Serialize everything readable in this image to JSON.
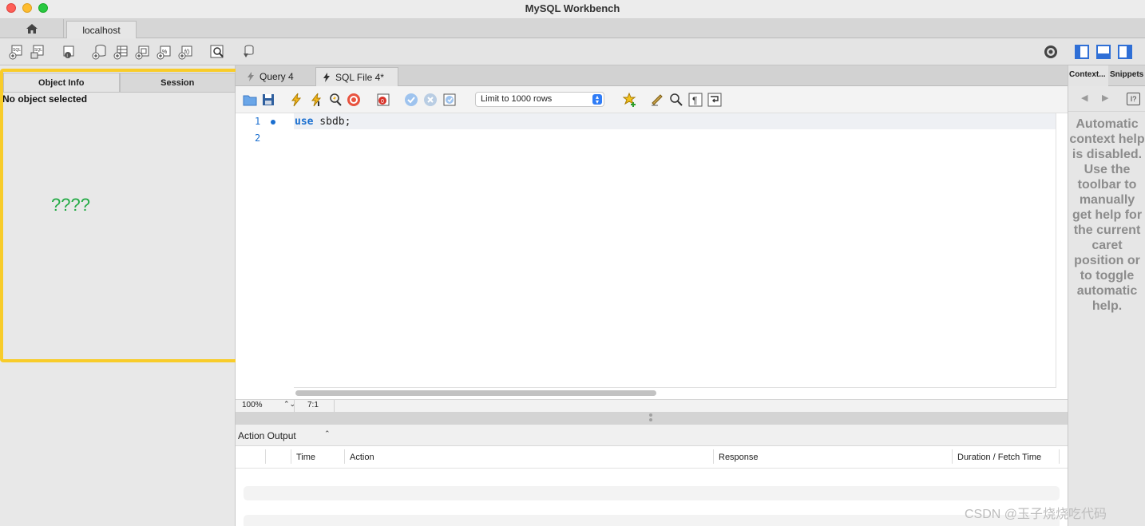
{
  "window": {
    "title": "MySQL Workbench"
  },
  "connection_tabs": {
    "home_icon": "home-icon",
    "active": "localhost"
  },
  "main_toolbar": {
    "icons": [
      "new-sql-tab-icon",
      "open-sql-script-icon",
      "inspector-icon",
      "create-schema-icon",
      "create-table-icon",
      "create-view-icon",
      "create-procedure-icon",
      "create-function-icon",
      "search-table-data-icon",
      "reconnect-icon"
    ],
    "right_icons": [
      "settings-icon",
      "toggle-sidebar-icon",
      "toggle-output-icon",
      "toggle-secondary-sidebar-icon"
    ]
  },
  "left_panel": {
    "tabs": [
      "Object Info",
      "Session"
    ],
    "active_tab": "Object Info",
    "message": "No object selected",
    "annotation": "????",
    "highlight_color": "#f8cc2a"
  },
  "editor": {
    "tabs": [
      {
        "label": "Query 4",
        "active": false
      },
      {
        "label": "SQL File 4*",
        "active": true
      }
    ],
    "limit_select": "Limit to 1000 rows",
    "lines": [
      {
        "num": "1",
        "keyword": "use",
        "rest": " sbdb;"
      },
      {
        "num": "2",
        "keyword": "",
        "rest": ""
      }
    ],
    "status": {
      "zoom": "100%",
      "position": "7:1"
    }
  },
  "output": {
    "selector": "Action Output",
    "columns": [
      "Time",
      "Action",
      "Response",
      "Duration / Fetch Time"
    ]
  },
  "right_panel": {
    "tabs": [
      "Context...",
      "Snippets"
    ],
    "help_text": "Automatic context help is disabled. Use the toolbar to manually get help for the current caret position or to toggle automatic help."
  },
  "watermark": "CSDN @玉子烧烧吃代码",
  "colors": {
    "accent": "#1a6fd0",
    "annotation": "#22aa44"
  }
}
